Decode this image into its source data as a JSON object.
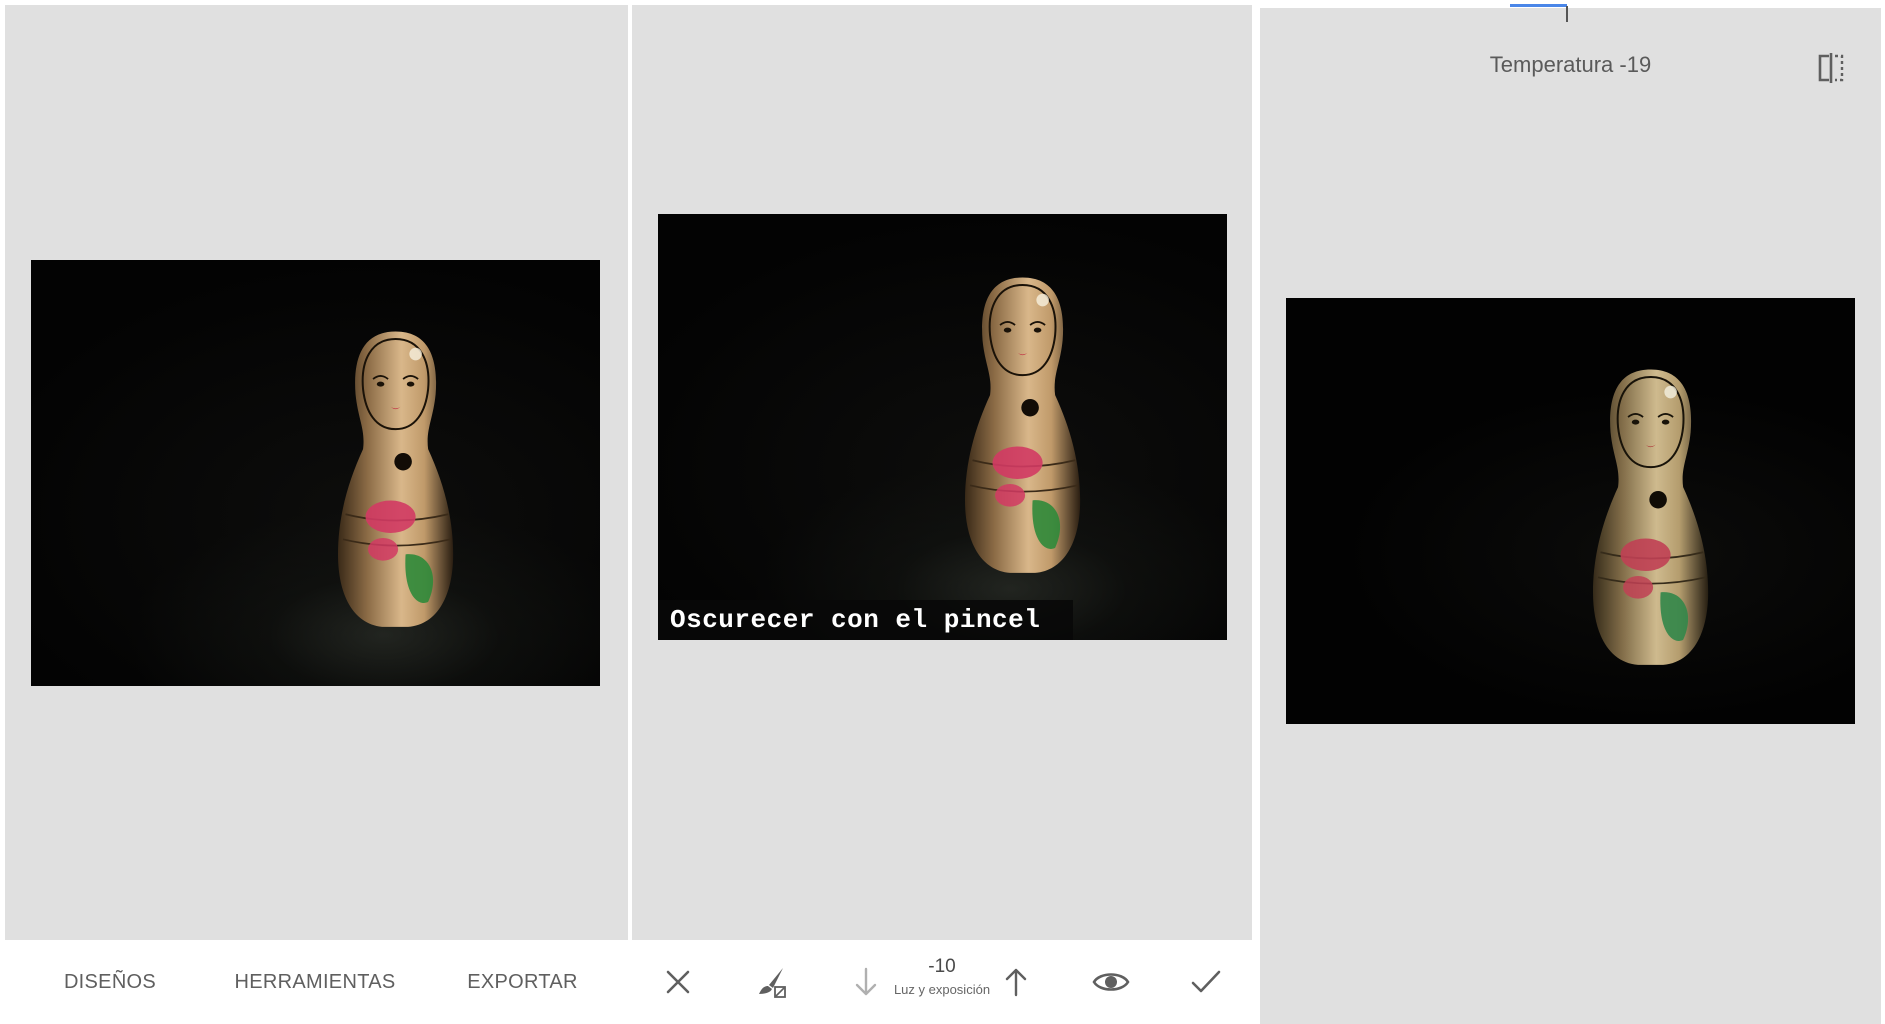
{
  "panel1": {
    "nav": [
      "DISEÑOS",
      "HERRAMIENTAS",
      "EXPORTAR"
    ]
  },
  "panel2": {
    "caption": "Oscurecer con el pincel",
    "toolbar": {
      "value": "-10",
      "label": "Luz y exposición",
      "icons": [
        "close-icon",
        "brush-icon",
        "arrow-down-icon",
        "arrow-up-icon",
        "eye-icon",
        "check-icon"
      ]
    }
  },
  "panel3": {
    "title": "Temperatura -19",
    "icons": [
      "compare-icon"
    ]
  },
  "colors": {
    "canvas": "#e0e0e0",
    "accent": "#4a86e8",
    "icon": "#5f5f5f",
    "icon_disabled": "#b0b0b0"
  }
}
